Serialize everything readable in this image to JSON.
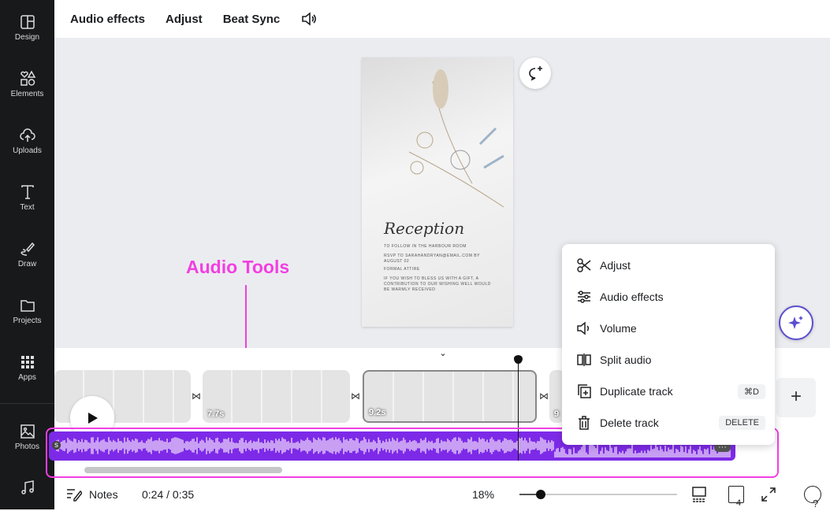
{
  "sidebar": {
    "items": [
      {
        "label": "Design",
        "icon": "layout-icon"
      },
      {
        "label": "Elements",
        "icon": "shapes-icon"
      },
      {
        "label": "Uploads",
        "icon": "cloud-upload-icon"
      },
      {
        "label": "Text",
        "icon": "text-icon"
      },
      {
        "label": "Draw",
        "icon": "pen-icon"
      },
      {
        "label": "Projects",
        "icon": "folder-icon"
      },
      {
        "label": "Apps",
        "icon": "grid-icon"
      },
      {
        "label": "Photos",
        "icon": "image-icon"
      },
      {
        "label": "",
        "icon": "music-icon"
      }
    ]
  },
  "toolbar": {
    "audio_effects": "Audio effects",
    "adjust": "Adjust",
    "beat_sync": "Beat Sync"
  },
  "card": {
    "title": "Reception",
    "line1": "TO FOLLOW IN THE HARBOUR ROOM",
    "line2": "RSVP TO SARAHANDRYAN@EMAIL.COM BY AUGUST 02",
    "line3": "FORMAL ATTIRE",
    "line4": "IF YOU WISH TO BLESS US WITH A GIFT, A CONTRIBUTION TO OUR WISHING WELL WOULD BE WARMLY RECEIVED"
  },
  "annotation": {
    "text": "Audio Tools",
    "color": "#f23fe2"
  },
  "timeline": {
    "clips": [
      {
        "duration": ""
      },
      {
        "duration": "7.7s"
      },
      {
        "duration": "9.2s"
      },
      {
        "duration": "9"
      }
    ],
    "audio_label": "s",
    "audio_color": "#7d2ae8"
  },
  "context_menu": {
    "items": [
      {
        "label": "Adjust",
        "icon": "scissors-icon"
      },
      {
        "label": "Audio effects",
        "icon": "sliders-icon"
      },
      {
        "label": "Volume",
        "icon": "speaker-icon"
      },
      {
        "label": "Split audio",
        "icon": "split-icon"
      },
      {
        "label": "Duplicate track",
        "icon": "duplicate-icon",
        "shortcut": "⌘D"
      },
      {
        "label": "Delete track",
        "icon": "trash-icon",
        "shortcut": "DELETE"
      }
    ]
  },
  "bottombar": {
    "notes": "Notes",
    "time": "0:24 / 0:35",
    "zoom": "18%",
    "zoom_level": 0.18,
    "pages": "4"
  }
}
